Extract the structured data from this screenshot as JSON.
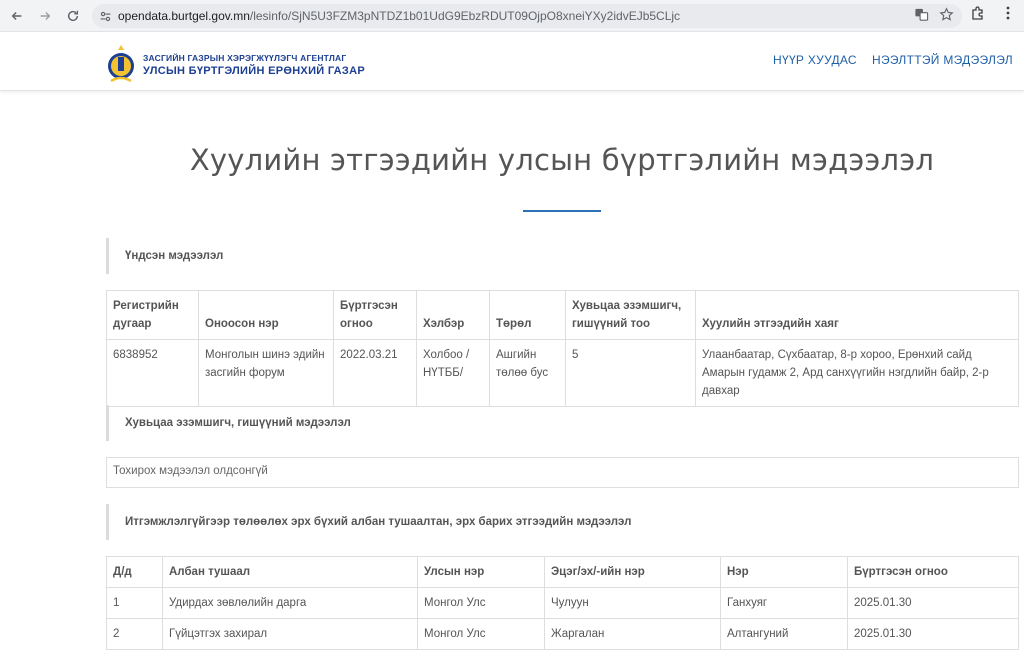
{
  "browser": {
    "url_host": "opendata.burtgel.gov.mn",
    "url_path": "/lesinfo/SjN5U3FZM3pNTDZ1b01UdG9EbzRDUT09OjpO8xneiYXy2idvEJb5CLjc"
  },
  "header": {
    "agency_line1": "ЗАСГИЙН ГАЗРЫН ХЭРЭГЖҮҮЛЭГЧ АГЕНТЛАГ",
    "agency_line2": "УЛСЫН БҮРТГЭЛИЙН ЕРӨНХИЙ ГАЗАР",
    "nav": [
      "НҮҮР ХУУДАС",
      "НЭЭЛТТЭЙ МЭДЭЭЛЭЛ"
    ]
  },
  "page": {
    "title": "Хуулийн этгээдийн улсын бүртгэлийн мэдээлэл"
  },
  "basic": {
    "heading": "Үндсэн мэдээлэл",
    "columns": [
      "Регистрийн дугаар",
      "Оноосон нэр",
      "Бүртгэсэн огноо",
      "Хэлбэр",
      "Төрөл",
      "Хувьцаа эзэмшигч, гишүүний тоо",
      "Хуулийн этгээдийн хаяг"
    ],
    "row": [
      "6838952",
      "Монголын шинэ эдийн засгийн форум",
      "2022.03.21",
      "Холбоо / НҮТББ/",
      "Ашгийн төлөө бус",
      "5",
      "Улаанбаатар, Сүхбаатар, 8-р хороо, Ерөнхий сайд Амарын гудамж 2, Ард санхүүгийн нэгдлийн байр, 2-р давхар"
    ]
  },
  "shareholders": {
    "heading": "Хувьцаа эзэмшигч, гишүүний мэдээлэл",
    "empty_text": "Тохирох мэдээлэл олдсонгүй"
  },
  "officials": {
    "heading": "Итгэмжлэлгүйгээр төлөөлөх эрх бүхий албан тушаалтан, эрх барих этгээдийн мэдээлэл",
    "columns": [
      "Д/д",
      "Албан тушаал",
      "Улсын нэр",
      "Эцэг/эх/-ийн нэр",
      "Нэр",
      "Бүртгэсэн огноо"
    ],
    "rows": [
      [
        "1",
        "Удирдах зөвлөлийн дарга",
        "Монгол Улс",
        "Чулуун",
        "Ганхуяг",
        "2025.01.30"
      ],
      [
        "2",
        "Гүйцэтгэх захирал",
        "Монгол Улс",
        "Жаргалан",
        "Алтангуний",
        "2025.01.30"
      ]
    ]
  },
  "colors": {
    "brand_blue": "#1d3f93",
    "link_blue": "#1f5fa8",
    "accent": "#2a72b5"
  }
}
